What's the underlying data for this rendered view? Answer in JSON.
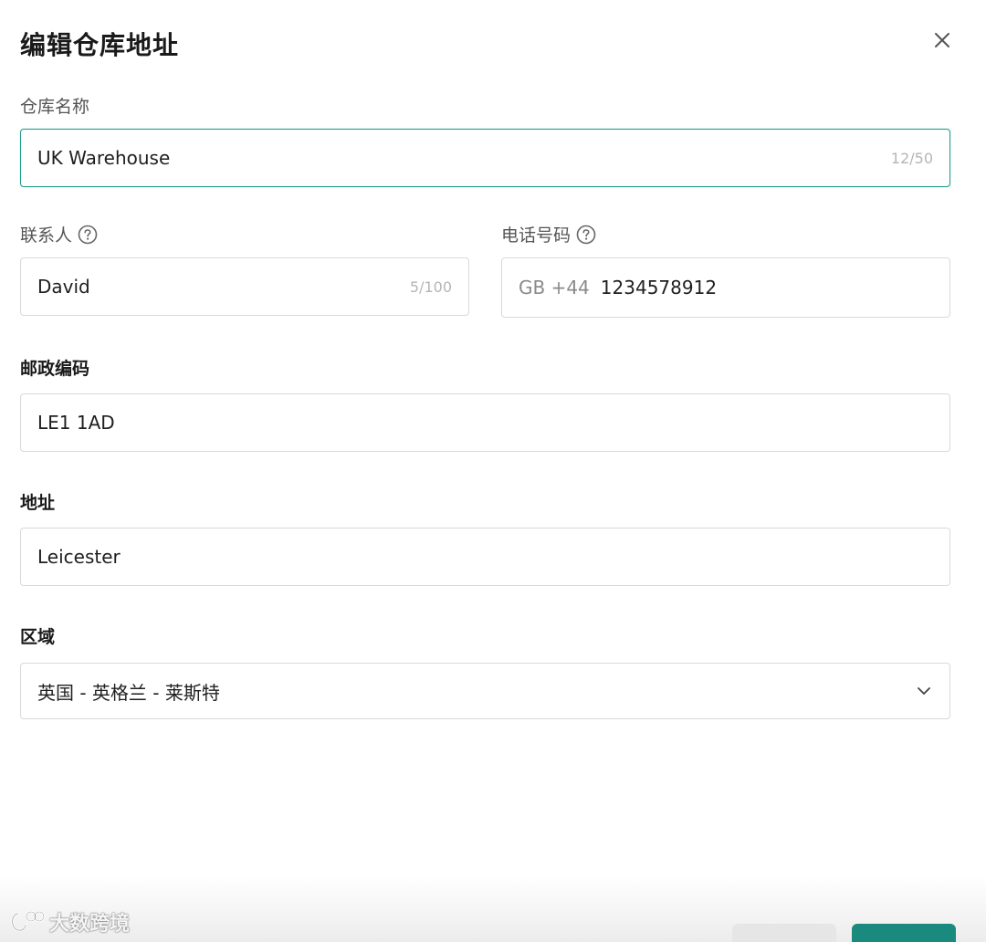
{
  "dialog": {
    "title": "编辑仓库地址"
  },
  "fields": {
    "warehouse_name": {
      "label": "仓库名称",
      "value": "UK Warehouse",
      "counter": "12/50"
    },
    "contact": {
      "label": "联系人",
      "value": "David",
      "counter": "5/100"
    },
    "phone": {
      "label": "电话号码",
      "prefix": "GB +44",
      "value": "1234578912"
    },
    "postal_code": {
      "label": "邮政编码",
      "value": "LE1 1AD"
    },
    "address": {
      "label": "地址",
      "value": "Leicester"
    },
    "region": {
      "label": "区域",
      "value": "英国 - 英格兰 - 莱斯特"
    }
  },
  "watermark": {
    "text": "大数跨境"
  },
  "colors": {
    "accent": "#1a8a7e",
    "focus_border": "#1f9c8c",
    "border": "#d9d9d9"
  },
  "icons": [
    "close-icon",
    "help-icon",
    "chevron-down-icon"
  ]
}
